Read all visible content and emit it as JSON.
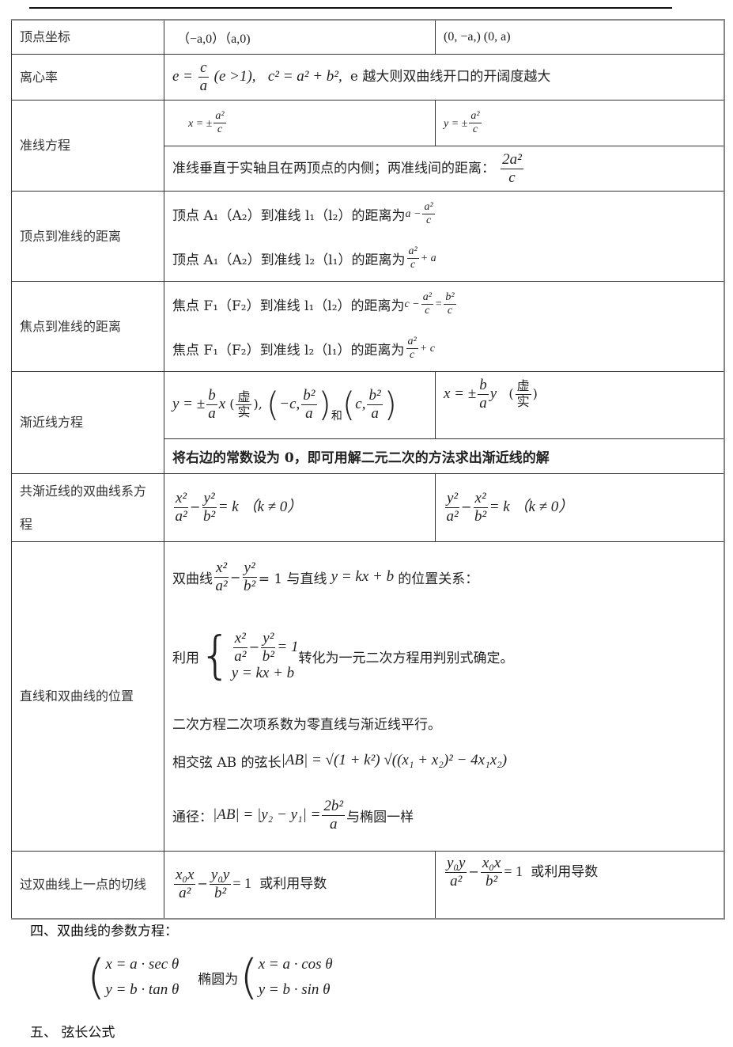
{
  "rows": {
    "vertex": {
      "label": "顶点坐标",
      "left": "（−a,0）（a,0)",
      "right": "(0, −a,)  (0,  a)"
    },
    "ecc": {
      "label": "离心率",
      "eq1_lhs": "e =",
      "num": "c",
      "den": "a",
      "cond": "(e >1),",
      "eq2": "c² = a² + b²,",
      "note": "e 越大则双曲线开口的开阔度越大"
    },
    "directrix": {
      "label": "准线方程",
      "left_lhs": "x = ±",
      "right_lhs": "y = ±",
      "num": "a²",
      "den": "c",
      "note": "准线垂直于实轴且在两顶点的内侧；两准线间的距离：",
      "dist_num": "2a²",
      "dist_den": "c"
    },
    "vertex_dir": {
      "label": "顶点到准线的距离",
      "line1": "顶点 A₁（A₂）到准线 l₁（l₂）的距离为",
      "line1_expr_pre": "a −",
      "line1_num": "a²",
      "line1_den": "c",
      "line2": "顶点 A₁（A₂）到准线 l₂（l₁）的距离为",
      "line2_num": "a²",
      "line2_den": "c",
      "line2_expr_post": "+ a"
    },
    "focus_dir": {
      "label": "焦点到准线的距离",
      "line1": "焦点 F₁（F₂）到准线 l₁（l₂）的距离为",
      "line1_pre": "c −",
      "line1_num": "a²",
      "line1_den": "c",
      "eq": "=",
      "line1_num2": "b²",
      "line1_den2": "c",
      "line2": "焦点 F₁（F₂）到准线 l₂（l₁）的距离为",
      "line2_num": "a²",
      "line2_den": "c",
      "line2_post": "+ c"
    },
    "asym": {
      "label": "渐近线方程",
      "left_lhs": "y = ±",
      "left_num": "b",
      "left_den": "a",
      "left_var": "x",
      "xu": "虚",
      "shi": "实",
      "pt1_pre": "−c,",
      "pt_num": "b²",
      "pt_den": "a",
      "he": "和",
      "pt2_pre": "c,",
      "right_lhs": "x = ±",
      "right_num": "b",
      "right_den": "a",
      "right_var": "y",
      "note": "将右边的常数设为 0，即可用解二元二次的方法求出渐近线的解"
    },
    "coasym": {
      "label": "共渐近线的双曲线系方程",
      "left_n1": "x²",
      "left_d1": "a²",
      "left_n2": "y²",
      "left_d2": "b²",
      "rhs": "= k （k ≠ 0）",
      "right_n1": "y²",
      "right_d1": "a²",
      "right_n2": "x²",
      "right_d2": "b²"
    },
    "position": {
      "label": "直线和双曲线的位置",
      "l1_pre": "双曲线",
      "n1": "x²",
      "d1": "a²",
      "n2": "y²",
      "d2": "b²",
      "l1_mid": "= 1 与直线",
      "l1_line": "y = kx + b",
      "l1_post": "的位置关系：",
      "l2_pre": "利用",
      "l2_eq2": "y = kx + b",
      "l2_eq1_rhs": "= 1",
      "l2_post": "转化为一元二次方程用判别式确定。",
      "l3": "二次方程二次项系数为零直线与渐近线平行。",
      "l4_pre": "相交弦 AB 的弦长",
      "l4_expr": "|AB| = √(1 + k²) √((x₁ + x₂)² − 4x₁x₂)",
      "l5_pre": "通径：",
      "l5_expr": "|AB| = |y₂ − y₁| =",
      "l5_num": "2b²",
      "l5_den": "a",
      "l5_post": "与椭圆一样"
    },
    "tangent": {
      "label": "过双曲线上一点的切线",
      "left_n1": "x₀x",
      "left_d1": "a²",
      "left_n2": "y₀y",
      "left_d2": "b²",
      "right_n1": "y₀y",
      "right_d1": "a²",
      "right_n2": "x₀x",
      "right_d2": "b²",
      "rhs": "= 1",
      "note": "或利用导数"
    }
  },
  "section4": {
    "title": "四、双曲线的参数方程：",
    "h1": "x = a · sec θ",
    "h2": "y = b · tan θ",
    "mid": "椭圆为",
    "e1": "x = a · cos θ",
    "e2": "y = b · sin θ"
  },
  "section5": {
    "title": "五、  弦长公式"
  }
}
